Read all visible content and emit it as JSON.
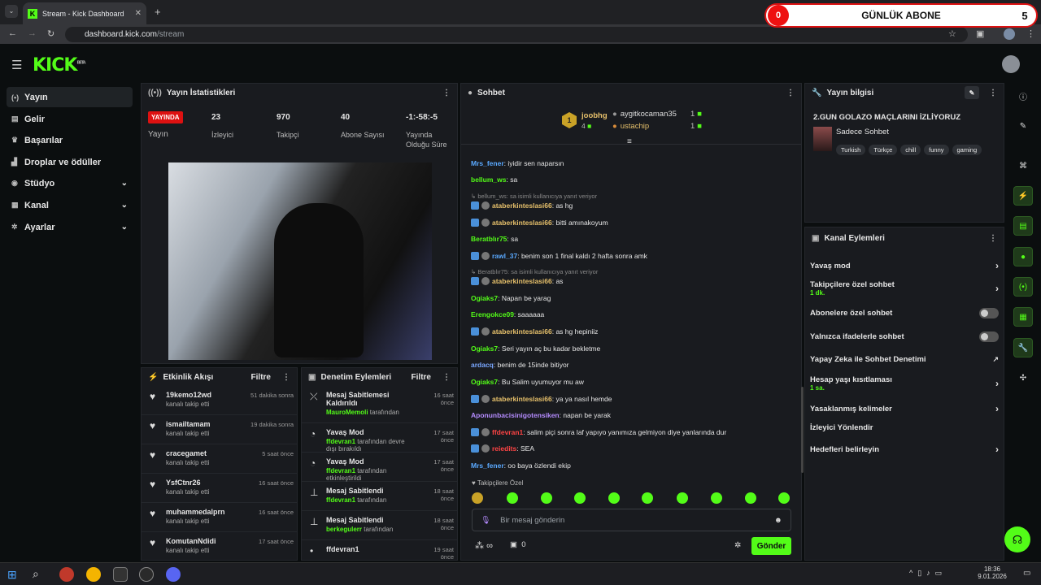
{
  "browser": {
    "tab_title": "Stream - Kick Dashboard",
    "url_host": "dashboard.kick.com",
    "url_path": "/stream",
    "tab_icon": "K"
  },
  "overlay": {
    "count": "0",
    "label": "GÜNLÜK ABONE",
    "goal": "5"
  },
  "logo": {
    "text": "KICK",
    "sup": "BETA"
  },
  "sidebar": {
    "items": [
      {
        "label": "Yayın",
        "icon": "broadcast-icon"
      },
      {
        "label": "Gelir",
        "icon": "revenue-icon"
      },
      {
        "label": "Başarılar",
        "icon": "trophy-icon"
      },
      {
        "label": "Droplar ve ödüller",
        "icon": "drops-icon"
      },
      {
        "label": "Stüdyo",
        "icon": "studio-icon"
      },
      {
        "label": "Kanal",
        "icon": "channel-icon"
      },
      {
        "label": "Ayarlar",
        "icon": "settings-icon"
      }
    ]
  },
  "stats": {
    "title": "Yayın İstatistikleri",
    "live_badge": "YAYINDA",
    "live_label": "Yayın",
    "viewers": "23",
    "viewers_label": "İzleyici",
    "followers": "970",
    "followers_label": "Takipçi",
    "subs": "40",
    "subs_label": "Abone Sayısı",
    "uptime": "-1:-58:-5",
    "uptime_label": "Yayında Olduğu Süre"
  },
  "activity": {
    "title": "Etkinlik Akışı",
    "filter": "Filtre",
    "items": [
      {
        "name": "19kemo12wd",
        "sub": "kanalı takip etti",
        "time": "51 dakika sonra"
      },
      {
        "name": "ismailtamam",
        "sub": "kanalı takip etti",
        "time": "19 dakika sonra"
      },
      {
        "name": "cracegamet",
        "sub": "kanalı takip etti",
        "time": "5 saat önce"
      },
      {
        "name": "YsfCtnr26",
        "sub": "kanalı takip etti",
        "time": "16 saat önce"
      },
      {
        "name": "muhammedalprn",
        "sub": "kanalı takip etti",
        "time": "16 saat önce"
      },
      {
        "name": "KomutanNdidi",
        "sub": "kanalı takip etti",
        "time": "17 saat önce"
      }
    ]
  },
  "moderation": {
    "title": "Denetim Eylemleri",
    "filter": "Filtre",
    "items": [
      {
        "title": "Mesaj Sabitlemesi Kaldırıldı",
        "user": "MauroMemoli",
        "suffix": "tarafından",
        "time": "16 saat önce"
      },
      {
        "title": "Yavaş Mod",
        "user": "ffdevran1",
        "suffix": "tarafından devre dışı bırakıldı",
        "time": "17 saat önce"
      },
      {
        "title": "Yavaş Mod",
        "user": "ffdevran1",
        "suffix": "tarafından etkinleştirildi",
        "time": "17 saat önce"
      },
      {
        "title": "Mesaj Sabitlendi",
        "user": "ffdevran1",
        "suffix": "tarafından",
        "time": "18 saat önce"
      },
      {
        "title": "Mesaj Sabitlendi",
        "user": "berkegulerr",
        "suffix": "tarafından",
        "time": "18 saat önce"
      },
      {
        "title": "ffdevran1",
        "user": "",
        "suffix": "",
        "time": "19 saat önce"
      }
    ]
  },
  "chat": {
    "title": "Sohbet",
    "top": [
      {
        "name": "joobhg",
        "count": "4"
      },
      {
        "name": "aygitkocaman35",
        "count": "1"
      },
      {
        "name": "ustachip",
        "count": "1"
      }
    ],
    "rank": "1",
    "messages": [
      {
        "user": "Mrs_fener",
        "color": "#5aa9ff",
        "text": "iyidir sen naparsın"
      },
      {
        "user": "bellum_ws",
        "color": "#53fc18",
        "text": "sa"
      },
      {
        "reply": "bellum_ws: sa isimli kullanıcıya yanıt veriyor"
      },
      {
        "user": "ataberkinteslasi66",
        "color": "#e6c06b",
        "text": "as hg",
        "badges": true
      },
      {
        "user": "ataberkinteslasi66",
        "color": "#e6c06b",
        "text": "bitti amınakoyum",
        "badges": true
      },
      {
        "user": "Beratblır75",
        "color": "#53fc18",
        "text": "sa"
      },
      {
        "user": "rawl_37",
        "color": "#5aa9ff",
        "text": "benim son 1 final kaldı 2 hafta sonra amk",
        "badges": true
      },
      {
        "reply": "Beratblır75: sa isimli kullanıcıya yanıt veriyor"
      },
      {
        "user": "ataberkinteslasi66",
        "color": "#e6c06b",
        "text": "as",
        "badges": true
      },
      {
        "user": "Ogiaks7",
        "color": "#53fc18",
        "text": "Napan be yarag"
      },
      {
        "user": "Erengokce09",
        "color": "#53fc18",
        "text": "saaaaaa"
      },
      {
        "user": "ataberkinteslasi66",
        "color": "#e6c06b",
        "text": "as hg hepiniiz",
        "badges": true
      },
      {
        "user": "Ogiaks7",
        "color": "#53fc18",
        "text": "Seri yayın aç bu kadar bekletme"
      },
      {
        "user": "ardacq",
        "color": "#7aa7ff",
        "text": "benim de 15inde bitiyor"
      },
      {
        "user": "Ogiaks7",
        "color": "#53fc18",
        "text": "Bu Salim uyumuyor mu aw"
      },
      {
        "user": "ataberkinteslasi66",
        "color": "#e6c06b",
        "text": "ya ya nasıl hemde",
        "badges": true
      },
      {
        "user": "Aponunbacisinigotensiken",
        "color": "#b58cff",
        "text": "napan be yarak"
      },
      {
        "user": "ffdevran1",
        "color": "#ff4444",
        "text": "salim piçi sonra laf yapıyo yanımıza gelmiyon diye yanlarında dur",
        "badges": true
      },
      {
        "user": "reiedits",
        "color": "#ff4444",
        "text": "SEA",
        "badges": true
      },
      {
        "user": "Mrs_fener",
        "color": "#5aa9ff",
        "text": "oo baya özlendi ekip"
      }
    ],
    "followers_only": "Takipçilere Özel",
    "placeholder": "Bir mesaj gönderin",
    "send": "Gönder",
    "infinity": "∞",
    "gift_count": "0"
  },
  "info": {
    "title": "Yayın bilgisi",
    "stream_title": "2.GUN GOLAZO MAÇLARINI İZLİYORUZ",
    "category": "Sadece Sohbet",
    "tags": [
      "Turkish",
      "Türkçe",
      "chill",
      "funny",
      "gaming"
    ]
  },
  "channel_actions": {
    "title": "Kanal Eylemleri",
    "items": [
      {
        "label": "Yavaş mod",
        "type": "chev"
      },
      {
        "label": "Takipçilere özel sohbet",
        "sub": "1 dk.",
        "type": "chev"
      },
      {
        "label": "Abonelere özel sohbet",
        "type": "toggle"
      },
      {
        "label": "Yalnızca ifadelerle sohbet",
        "type": "toggle"
      },
      {
        "label": "Yapay Zeka ile Sohbet Denetimi",
        "type": "ext"
      },
      {
        "label": "Hesap yaşı kısıtlaması",
        "sub": "1 sa.",
        "type": "chev"
      },
      {
        "label": "Yasaklanmış kelimeler",
        "type": "chev"
      },
      {
        "label": "İzleyici Yönlendir",
        "type": "none"
      },
      {
        "label": "Hedefleri belirleyin",
        "type": "chev"
      }
    ]
  },
  "taskbar": {
    "time": "18:36",
    "date": "9.01.2026"
  }
}
